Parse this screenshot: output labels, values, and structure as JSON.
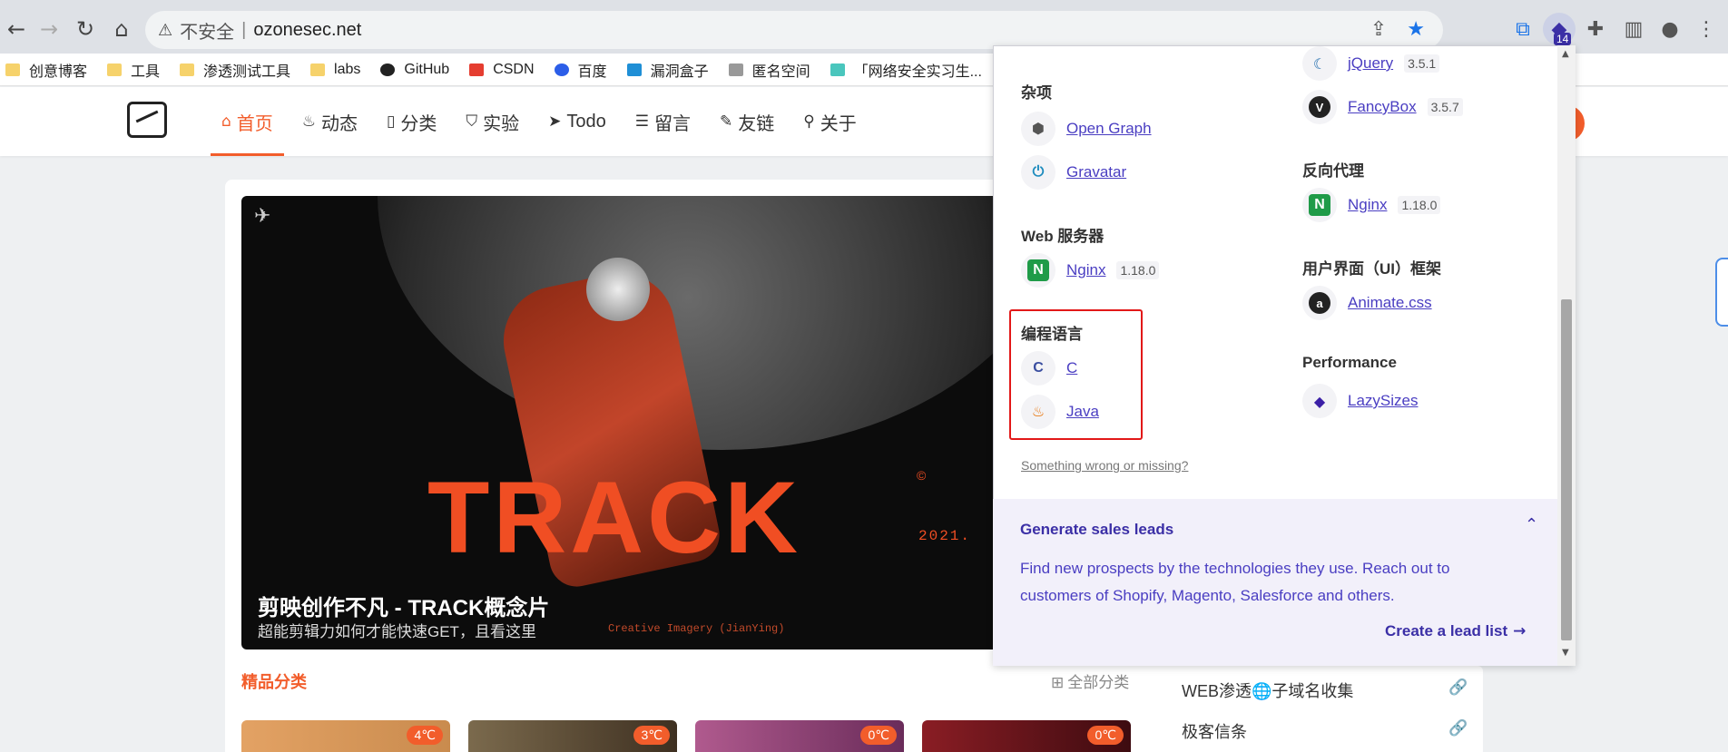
{
  "browser": {
    "security_label": "不安全",
    "separator": "|",
    "url": "ozonesec.net",
    "badge_count": "14"
  },
  "bookmarks": [
    "创意博客",
    "工具",
    "渗透测试工具",
    "labs",
    "GitHub",
    "CSDN",
    "百度",
    "漏洞盒子",
    "匿名空间",
    "「网络安全实习生..."
  ],
  "site": {
    "nav": [
      {
        "icon": "⌂",
        "label": "首页"
      },
      {
        "icon": "♨",
        "label": "动态"
      },
      {
        "icon": "▯",
        "label": "分类"
      },
      {
        "icon": "⛉",
        "label": "实验"
      },
      {
        "icon": "➤",
        "label": "Todo"
      },
      {
        "icon": "☰",
        "label": "留言"
      },
      {
        "icon": "✎",
        "label": "友链"
      },
      {
        "icon": "⚲",
        "label": "关于"
      }
    ]
  },
  "banner": {
    "art_word": "TRACK",
    "copyright": "©",
    "year": "2021.",
    "title": "剪映创作不凡 - TRACK概念片",
    "subtitle": "超能剪辑力如何才能快速GET，且看这里",
    "credit": "Creative Imagery (JianYing)"
  },
  "featured": {
    "title": "精品分类",
    "all_label": "全部分类",
    "temps": [
      "4℃",
      "3℃",
      "0℃",
      "0℃"
    ]
  },
  "sidebar_links": [
    "WEB渗透🌐子域名收集",
    "极客信条"
  ],
  "wappalyzer": {
    "left": {
      "misc": {
        "title": "杂项",
        "items": [
          {
            "name": "Open Graph"
          },
          {
            "name": "Gravatar"
          }
        ]
      },
      "web_server": {
        "title": "Web 服务器",
        "items": [
          {
            "name": "Nginx",
            "version": "1.18.0"
          }
        ]
      },
      "languages": {
        "title": "编程语言",
        "items": [
          {
            "name": "C"
          },
          {
            "name": "Java"
          }
        ]
      }
    },
    "right": {
      "js_libs": {
        "items": [
          {
            "name": "jQuery",
            "version": "3.5.1"
          },
          {
            "name": "FancyBox",
            "version": "3.5.7"
          }
        ]
      },
      "reverse_proxy": {
        "title": "反向代理",
        "items": [
          {
            "name": "Nginx",
            "version": "1.18.0"
          }
        ]
      },
      "ui_framework": {
        "title": "用户界面（UI）框架",
        "items": [
          {
            "name": "Animate.css"
          }
        ]
      },
      "performance": {
        "title": "Performance",
        "items": [
          {
            "name": "LazySizes"
          }
        ]
      }
    },
    "missing_link": "Something wrong or missing?",
    "leads": {
      "title": "Generate sales leads",
      "description": "Find new prospects by the technologies they use. Reach out to customers of Shopify, Magento, Salesforce and others.",
      "cta": "Create a lead list"
    }
  }
}
